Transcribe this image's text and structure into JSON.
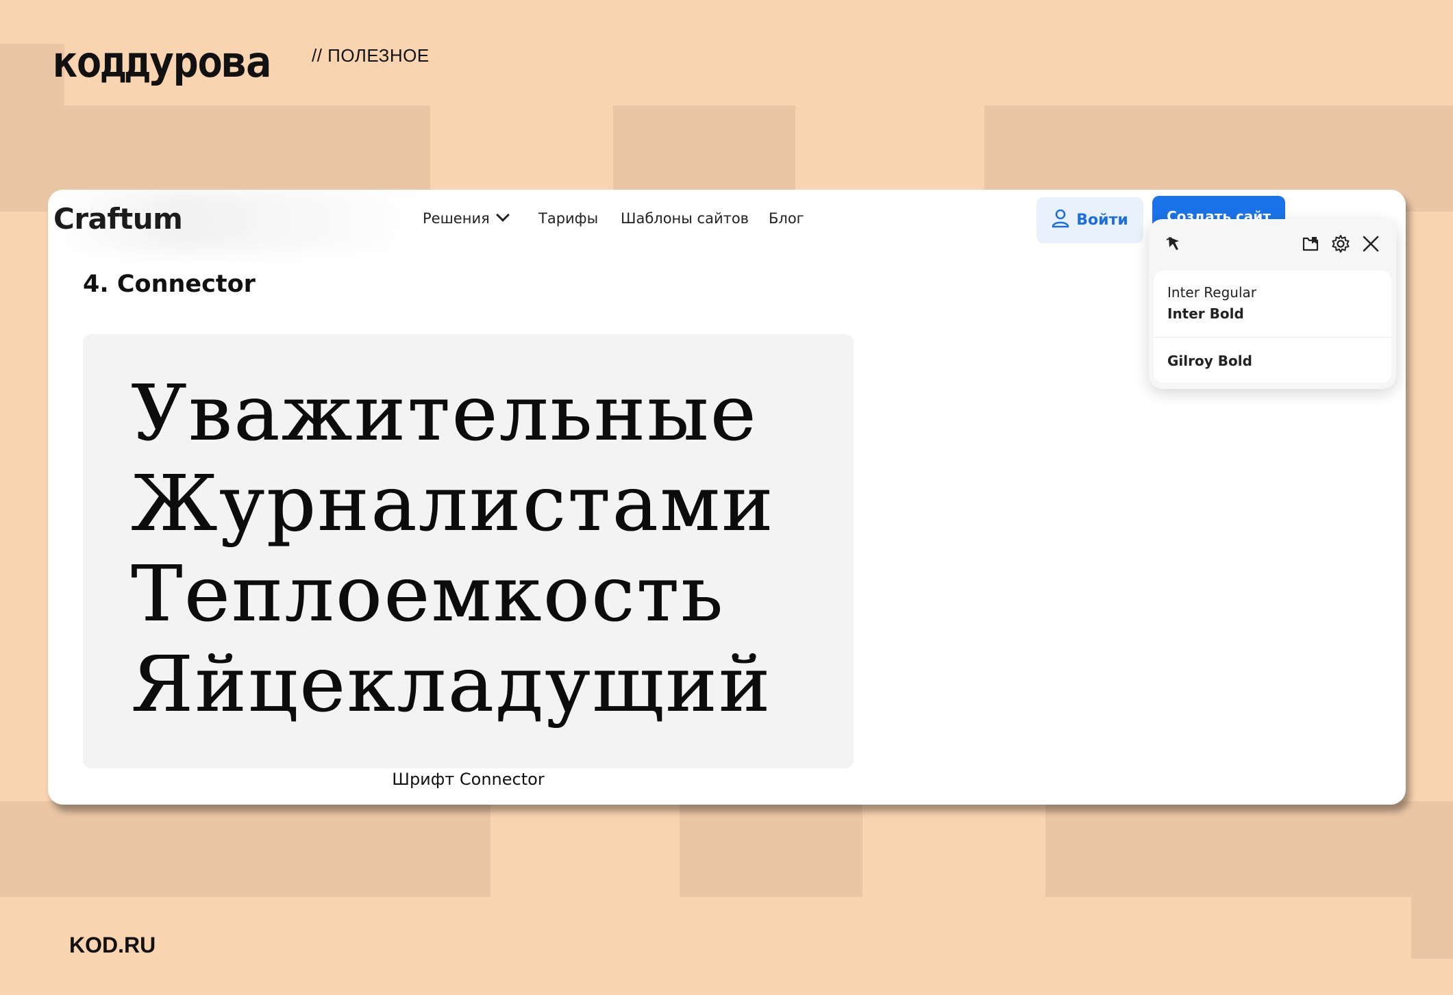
{
  "header": {
    "brand": "КОДДУРОВА",
    "section": "// ПОЛЕЗНОЕ"
  },
  "footer": {
    "site": "KOD.RU"
  },
  "site": {
    "logo": "Craftum",
    "nav": [
      {
        "label": "Решения"
      },
      {
        "label": "Тарифы"
      },
      {
        "label": "Шаблоны сайтов"
      },
      {
        "label": "Блог"
      }
    ],
    "login_label": "Войти",
    "create_label": "Создать сайт"
  },
  "article": {
    "heading": "4. Connector",
    "sample_lines": [
      "Уважительные",
      "Журналистами",
      "Теплоемкость",
      "Яйцекладущий"
    ],
    "caption": "Шрифт Connector"
  },
  "popup": {
    "icons": [
      "font-picker-icon",
      "save-icon",
      "gear-icon",
      "close-icon"
    ],
    "fonts": [
      "Inter Regular",
      "Inter Bold",
      "Gilroy Bold"
    ]
  },
  "colors": {
    "background": "#f8d4b0",
    "background_blocks": "#eac6a5",
    "accent_blue": "#1a73e8",
    "login_bg": "#e9f1fd"
  }
}
